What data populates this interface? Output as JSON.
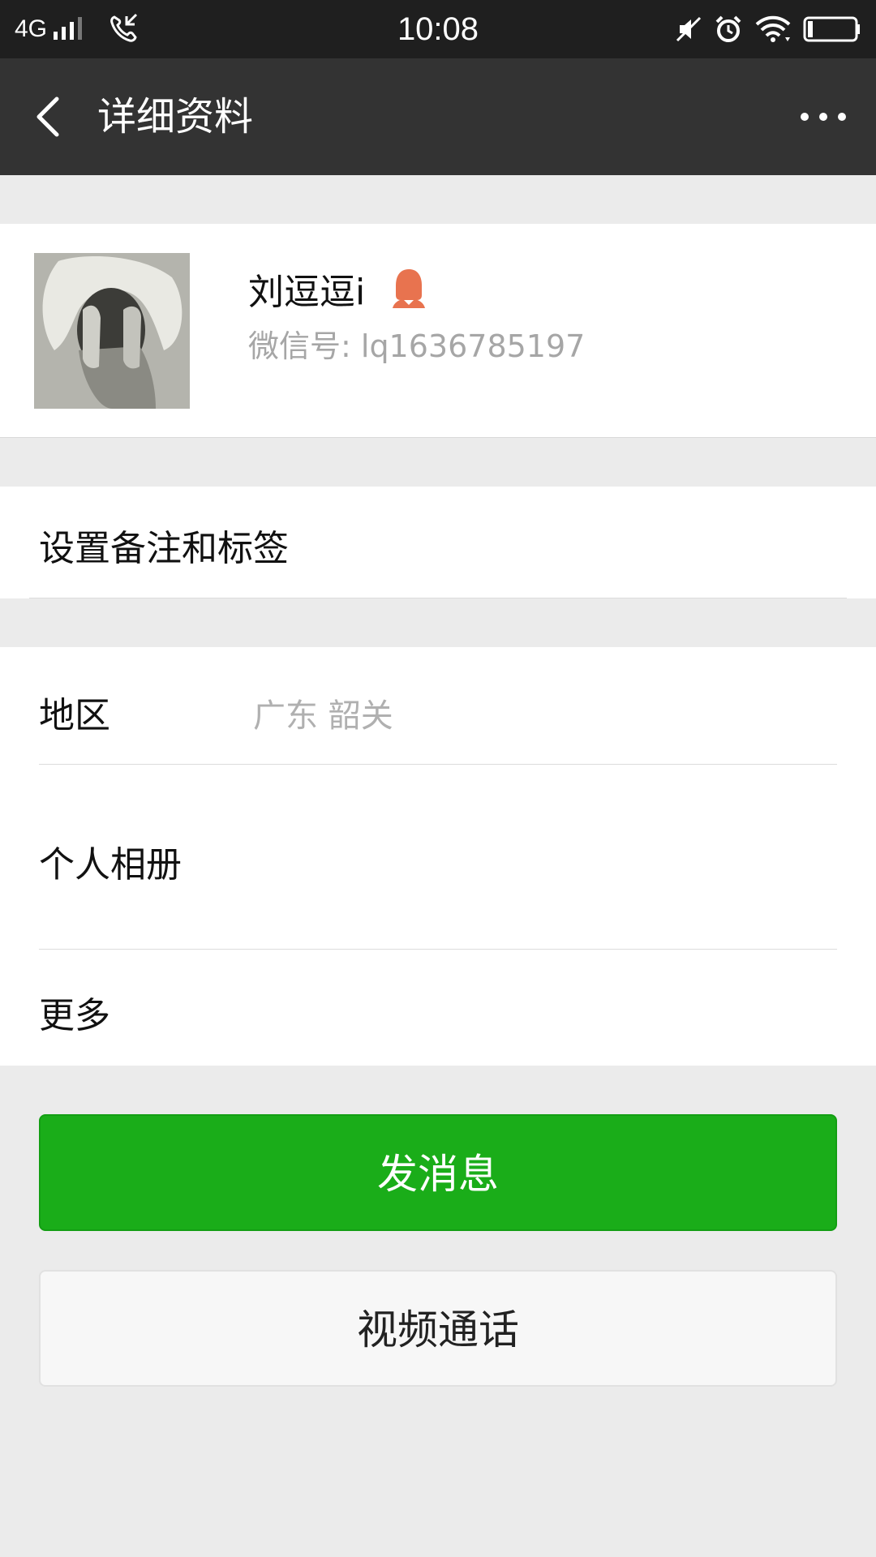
{
  "status_bar": {
    "network": "4G",
    "time": "10:08"
  },
  "nav": {
    "title": "详细资料"
  },
  "profile": {
    "name": "刘逗逗i",
    "wechat_id": "微信号: lq1636785197",
    "gender_icon": "female-icon",
    "gender_color": "#e8734f"
  },
  "remark": {
    "label": "设置备注和标签"
  },
  "info": {
    "region_label": "地区",
    "region_value": "广东  韶关",
    "album_label": "个人相册",
    "more_label": "更多"
  },
  "actions": {
    "send_message": "发消息",
    "video_call": "视频通话"
  },
  "colors": {
    "accent_green": "#1aad19",
    "nav_bg": "#333333",
    "status_bg": "#1f1f1f"
  }
}
